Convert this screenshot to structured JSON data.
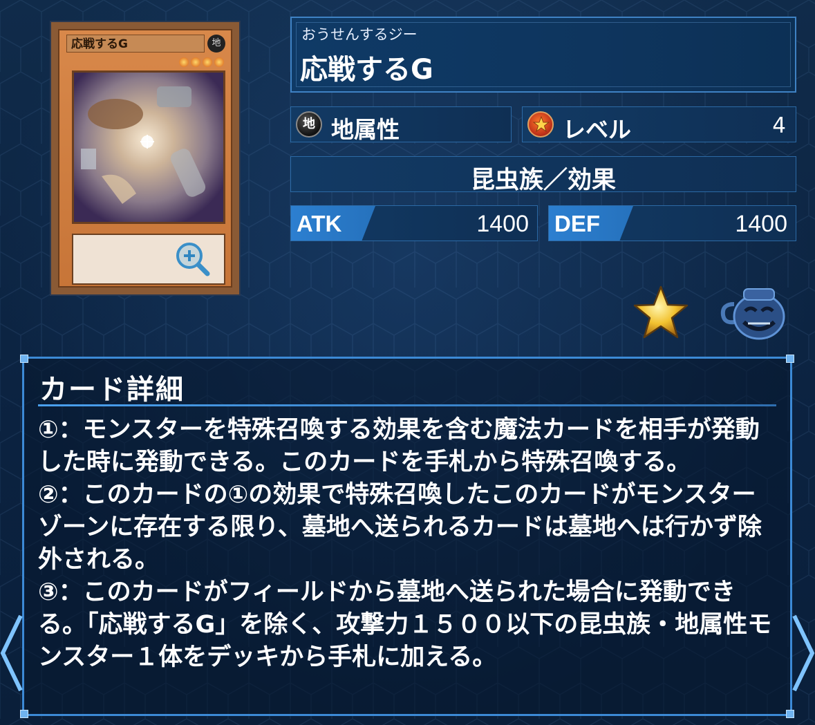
{
  "card": {
    "image_title": "応戦するG",
    "image_attr_glyph": "地",
    "reading": "おうせんするジー",
    "name": "応戦するG"
  },
  "attribute": {
    "icon": "earth-attribute-icon",
    "icon_glyph": "地",
    "label": "地属性"
  },
  "level": {
    "icon": "level-star-icon",
    "label": "レベル",
    "value": "4"
  },
  "race": "昆虫族／効果",
  "atk": {
    "label": "ATK",
    "value": "1400"
  },
  "def": {
    "label": "DEF",
    "value": "1400"
  },
  "actions": {
    "favorite_icon": "star-icon",
    "pot_icon": "pot-of-greed-icon",
    "zoom_icon": "zoom-in-icon"
  },
  "detail": {
    "title": "カード詳細",
    "effects": [
      "①：モンスターを特殊召喚する効果を含む魔法カードを相手が発動した時に発動できる。このカードを手札から特殊召喚する。",
      "②：このカードの①の効果で特殊召喚したこのカードがモンスターゾーンに存在する限り、墓地へ送られるカードは墓地へは行かず除外される。",
      "③：このカードがフィールドから墓地へ送られた場合に発動できる。「応戦するG」を除く、攻撃力１５００以下の昆虫族・地属性モンスター１体をデッキから手札に加える。"
    ]
  },
  "nav": {
    "prev_icon": "chevron-left-icon",
    "next_icon": "chevron-right-icon"
  },
  "colors": {
    "accent": "#3c8ad6",
    "tag": "#2c7fd0",
    "background": "#0d2642"
  }
}
